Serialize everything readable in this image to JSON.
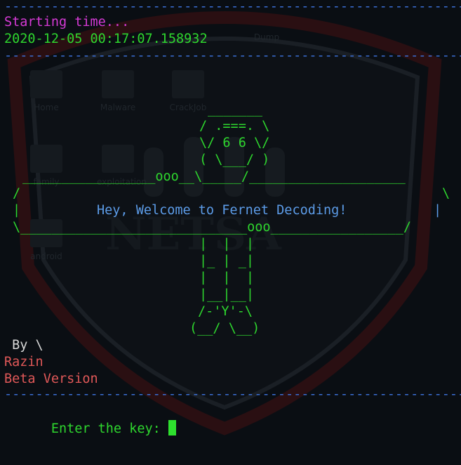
{
  "wallpaper": {
    "icons": [
      {
        "label": "Dump"
      },
      {
        "label": "Home"
      },
      {
        "label": "Malware"
      },
      {
        "label": "CrackJob"
      },
      {
        "label": "family"
      },
      {
        "label": "exploitation"
      },
      {
        "label": "android"
      }
    ],
    "logo_text": "NETSA"
  },
  "terminal": {
    "rule_top": "----------------------------------------------------------------",
    "start_label": "Starting time...",
    "start_timestamp": "2020-12-05 00:17:07.158932",
    "rule_mid": "----------------------------------------------------------------",
    "art": {
      "line1": "_______",
      "line2": "/ .===. \\",
      "line3": "\\/ 6 6 \\/",
      "line4": "( \\___/ )",
      "line5": "_________________ooo__\\_____/____________________",
      "line6_left": "/",
      "line6_right": "\\",
      "banner_left": "|",
      "banner_text": "Hey, Welcome to Fernet Decoding!",
      "banner_right": "|",
      "line8": "\\_____________________________ooo_________________/",
      "line9": "|  |  |",
      "line10": "|_ | _|",
      "line11": "|  |  |",
      "line12": "|__|__|",
      "line13": "/-'Y'-\\",
      "line14": "(__/ \\__)"
    },
    "by_label": " By \\",
    "author": "Razin",
    "version": "Beta Version",
    "rule_bottom": "----------------------------------------------------------------",
    "prompt": "Enter the key: "
  },
  "colors": {
    "rule": "#3b6fd6",
    "header": "#d63ad6",
    "art": "#2ed62e",
    "banner_text": "#5c9ce8",
    "author": "#e05858",
    "cursor": "#2ee02e"
  }
}
